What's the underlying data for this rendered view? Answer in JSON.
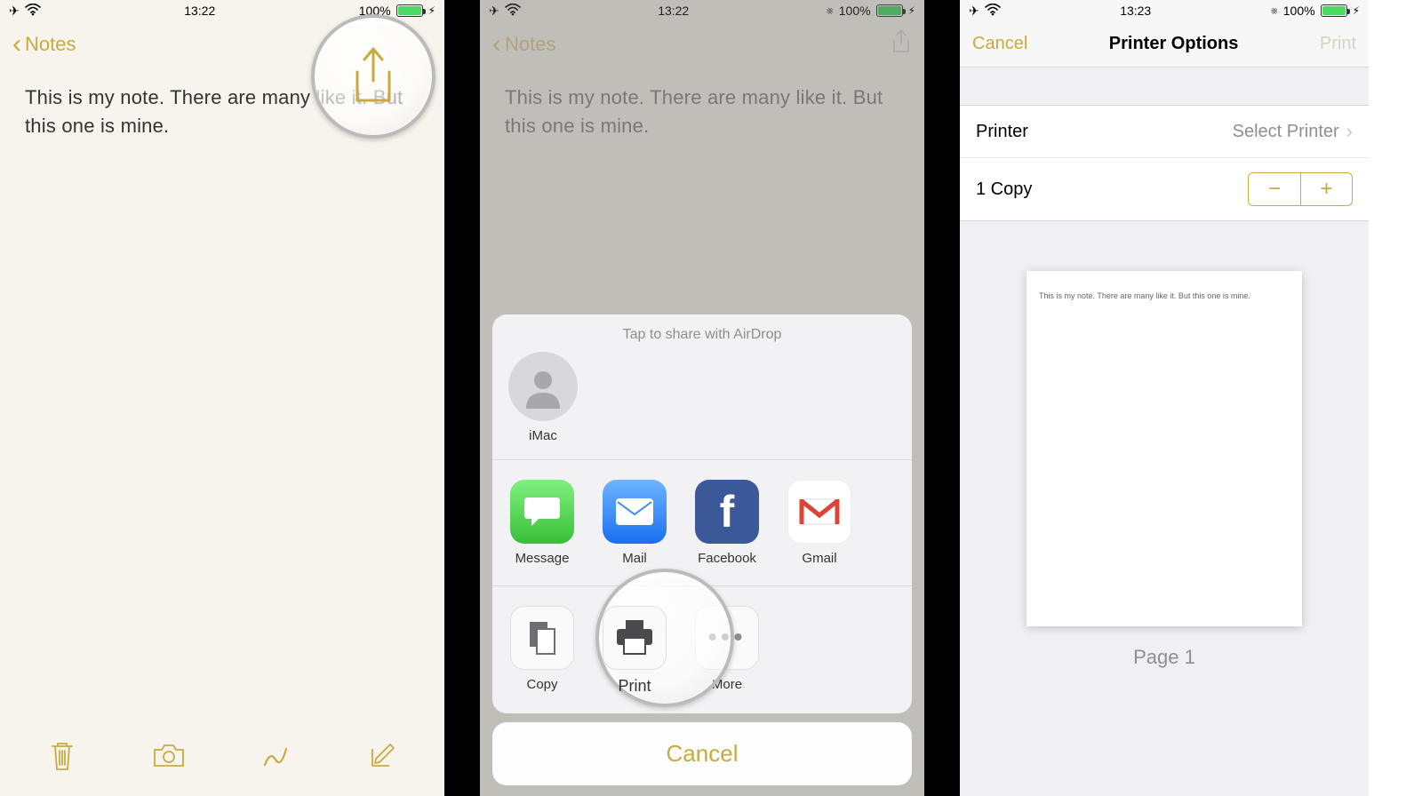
{
  "panel1": {
    "status": {
      "time": "13:22",
      "battery": "100%"
    },
    "nav": {
      "back": "Notes"
    },
    "note_text": "This is my note. There are many like it. But this one is mine."
  },
  "panel2": {
    "status": {
      "time": "13:22",
      "battery": "100%"
    },
    "nav": {
      "back": "Notes"
    },
    "note_text": "This is my note. There are many like it. But this one is mine.",
    "sheet": {
      "airdrop_title": "Tap to share with AirDrop",
      "contacts": [
        {
          "name": "iMac"
        }
      ],
      "apps": [
        {
          "name": "Message",
          "bg": "#57d057"
        },
        {
          "name": "Mail",
          "bg": "#3a8def"
        },
        {
          "name": "Facebook",
          "bg": "#3b5998"
        },
        {
          "name": "Gmail",
          "bg": "#ffffff"
        }
      ],
      "actions": [
        {
          "name": "Copy"
        },
        {
          "name": "Print"
        },
        {
          "name": "More"
        }
      ],
      "cancel": "Cancel"
    }
  },
  "panel3": {
    "status": {
      "time": "13:23",
      "battery": "100%"
    },
    "nav": {
      "cancel": "Cancel",
      "title": "Printer Options",
      "print": "Print"
    },
    "rows": {
      "printer_label": "Printer",
      "printer_value": "Select Printer",
      "copies_label": "1 Copy"
    },
    "preview": {
      "text": "This is my note. There are many like it. But this one is mine.",
      "page_label": "Page 1"
    }
  }
}
